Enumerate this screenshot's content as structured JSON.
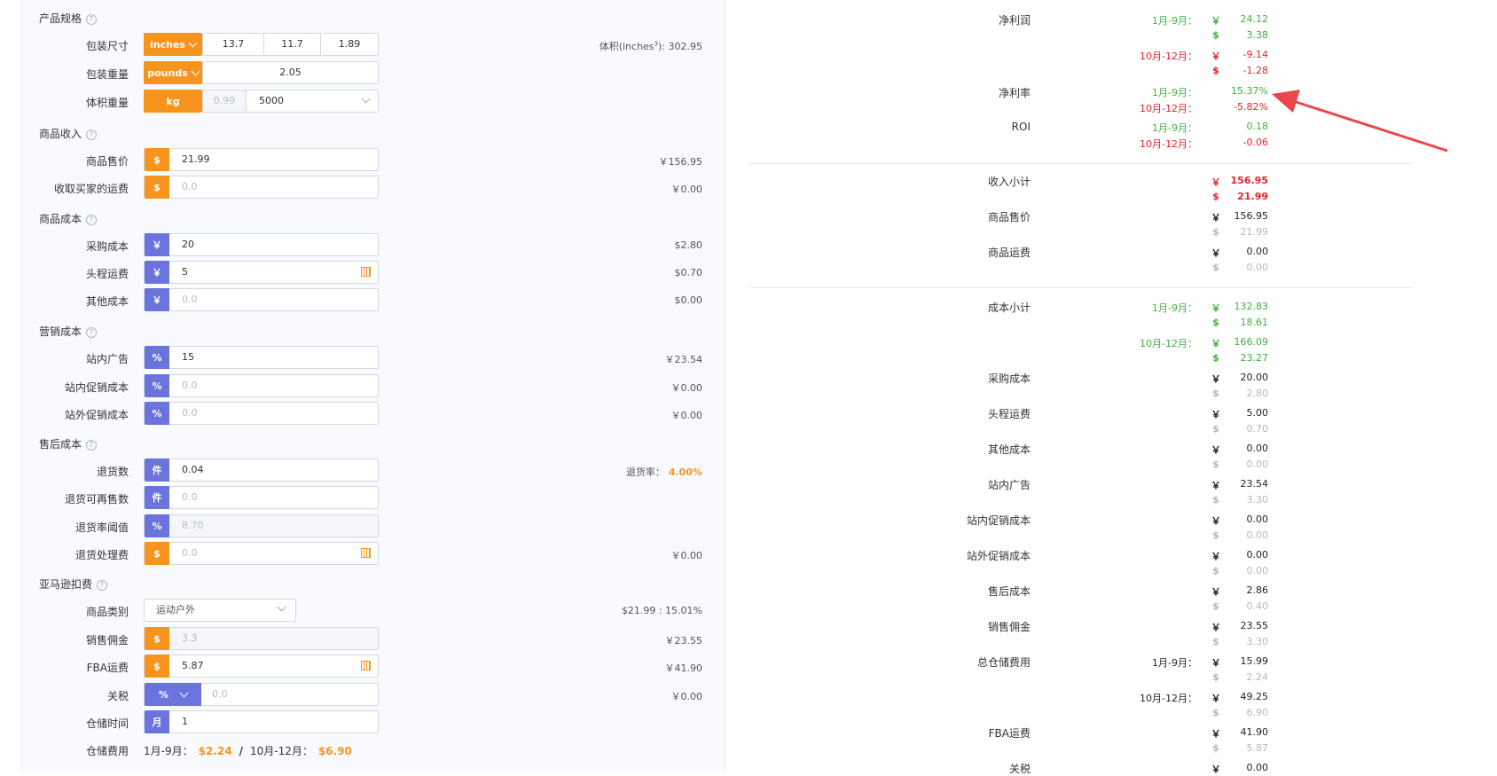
{
  "left": {
    "sections": {
      "spec": "产品规格",
      "income": "商品收入",
      "cost": "商品成本",
      "marketing": "营销成本",
      "aftersale": "售后成本",
      "amazon": "亚马逊扣费"
    },
    "help_glyph": "?",
    "pkg_size": {
      "label": "包装尺寸",
      "unit": "inches",
      "l": "13.7",
      "w": "11.7",
      "h": "1.89",
      "volume_label": "体积(inches",
      "volume_sup": "3",
      "volume_value": "): 302.95"
    },
    "pkg_weight": {
      "label": "包装重量",
      "unit": "pounds",
      "value": "2.05"
    },
    "vol_weight": {
      "label": "体积重量",
      "unit": "kg",
      "value": "0.99",
      "divisor": "5000"
    },
    "price": {
      "label": "商品售价",
      "addon": "$",
      "value": "21.99",
      "right": "￥156.95"
    },
    "shipping_recv": {
      "label": "收取买家的运费",
      "addon": "$",
      "placeholder": "0.0",
      "right": "￥0.00"
    },
    "purchase": {
      "label": "采购成本",
      "addon": "￥",
      "value": "20",
      "right": "$2.80"
    },
    "first_leg": {
      "label": "头程运费",
      "addon": "￥",
      "value": "5",
      "right": "$0.70"
    },
    "other_cost": {
      "label": "其他成本",
      "addon": "￥",
      "placeholder": "0.0",
      "right": "$0.00"
    },
    "onsite_ads": {
      "label": "站内广告",
      "addon": "%",
      "value": "15",
      "right": "￥23.54"
    },
    "onsite_promo": {
      "label": "站内促销成本",
      "addon": "%",
      "placeholder": "0.0",
      "right": "￥0.00"
    },
    "offsite_promo": {
      "label": "站外促销成本",
      "addon": "%",
      "placeholder": "0.0",
      "right": "￥0.00"
    },
    "returns": {
      "label": "退货数",
      "addon": "件",
      "value": "0.04",
      "rate_label": "退货率：",
      "rate_value": "4.00%"
    },
    "resellable": {
      "label": "退货可再售数",
      "addon": "件",
      "placeholder": "0.0"
    },
    "return_threshold": {
      "label": "退货率阈值",
      "addon": "%",
      "value": "8.70"
    },
    "return_fee": {
      "label": "退货处理费",
      "addon": "$",
      "placeholder": "0.0",
      "right": "￥0.00"
    },
    "category": {
      "label": "商品类别",
      "value": "运动户外",
      "right": "$21.99 : 15.01%"
    },
    "commission": {
      "label": "销售佣金",
      "addon": "$",
      "value": "3.3",
      "right": "￥23.55"
    },
    "fba": {
      "label": "FBA运费",
      "addon": "$",
      "value": "5.87",
      "right": "￥41.90"
    },
    "tariff": {
      "label": "关税",
      "addon": "%",
      "placeholder": "0.0",
      "right": "￥0.00"
    },
    "storage_time": {
      "label": "仓储时间",
      "addon": "月",
      "value": "1"
    },
    "storage_fee": {
      "label": "仓储费用",
      "p1": "1月-9月：",
      "v1": "$2.24",
      "sep": "/",
      "p2": "10月-12月：",
      "v2": "$6.90"
    }
  },
  "right": {
    "net_profit": {
      "label": "净利润",
      "p1": "1月-9月：",
      "p1_cny": "24.12",
      "p1_usd": "3.38",
      "p2": "10月-12月：",
      "p2_cny": "-9.14",
      "p2_usd": "-1.28"
    },
    "net_margin": {
      "label": "净利率",
      "p1": "1月-9月：",
      "v1": "15.37%",
      "p2": "10月-12月：",
      "v2": "-5.82%"
    },
    "roi": {
      "label": "ROI",
      "p1": "1月-9月：",
      "v1": "0.18",
      "p2": "10月-12月：",
      "v2": "-0.06"
    },
    "income_total": {
      "label": "收入小计",
      "cny": "156.95",
      "usd": "21.99"
    },
    "price": {
      "label": "商品售价",
      "cny": "156.95",
      "usd": "21.99"
    },
    "shipping": {
      "label": "商品运费",
      "cny": "0.00",
      "usd": "0.00"
    },
    "cost_total": {
      "label": "成本小计",
      "p1": "1月-9月：",
      "p1_cny": "132.83",
      "p1_usd": "18.61",
      "p2": "10月-12月：",
      "p2_cny": "166.09",
      "p2_usd": "23.27"
    },
    "items": [
      {
        "label": "采购成本",
        "cny": "20.00",
        "usd": "2.80"
      },
      {
        "label": "头程运费",
        "cny": "5.00",
        "usd": "0.70"
      },
      {
        "label": "其他成本",
        "cny": "0.00",
        "usd": "0.00"
      },
      {
        "label": "站内广告",
        "cny": "23.54",
        "usd": "3.30"
      },
      {
        "label": "站内促销成本",
        "cny": "0.00",
        "usd": "0.00"
      },
      {
        "label": "站外促销成本",
        "cny": "0.00",
        "usd": "0.00"
      },
      {
        "label": "售后成本",
        "cny": "2.86",
        "usd": "0.40"
      },
      {
        "label": "销售佣金",
        "cny": "23.55",
        "usd": "3.30"
      }
    ],
    "storage": {
      "label": "总仓储费用",
      "p1": "1月-9月：",
      "p1_cny": "15.99",
      "p1_usd": "2.24",
      "p2": "10月-12月：",
      "p2_cny": "49.25",
      "p2_usd": "6.90"
    },
    "fba": {
      "label": "FBA运费",
      "cny": "41.90",
      "usd": "5.87"
    },
    "tariff": {
      "label": "关税",
      "cny": "0.00"
    },
    "cny_sym": "￥",
    "usd_sym": "$"
  },
  "colors": {
    "orange": "#f7941d",
    "purple": "#6b73dc",
    "green": "#3fb13f",
    "red": "#e8212a",
    "arrow": "#e8474c"
  }
}
